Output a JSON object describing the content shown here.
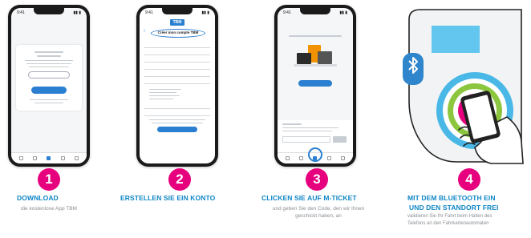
{
  "steps": [
    {
      "number": "1",
      "title": "DOWNLOAD",
      "description": "die kostenlose App TBM"
    },
    {
      "number": "2",
      "title": "ERSTELLEN SIE EIN KONTO",
      "description": ""
    },
    {
      "number": "3",
      "title": "CLICKEN SIE AUF M-TICKET",
      "description_lines": [
        "und geben Sie den Code, den wir Ihnen",
        "geschickt haben, an"
      ]
    },
    {
      "number": "4",
      "title_lines": [
        "MIT DEM BLUETOOTH EIN",
        "UND DEN STANDORT FREI"
      ],
      "description_lines": [
        "validieren Sie Ihr Fahrt beim Halten des",
        "Telefons an den Fahrkartenautomaten"
      ]
    }
  ],
  "phone2": {
    "brand": "TBM",
    "header": "Créer mon compte TBM"
  },
  "colors": {
    "accent_blue": "#0e86c6",
    "badge_pink": "#e6007e",
    "validator_cyan": "#49b8e6",
    "validator_green": "#8cc63f",
    "validator_magenta": "#e6007e"
  }
}
